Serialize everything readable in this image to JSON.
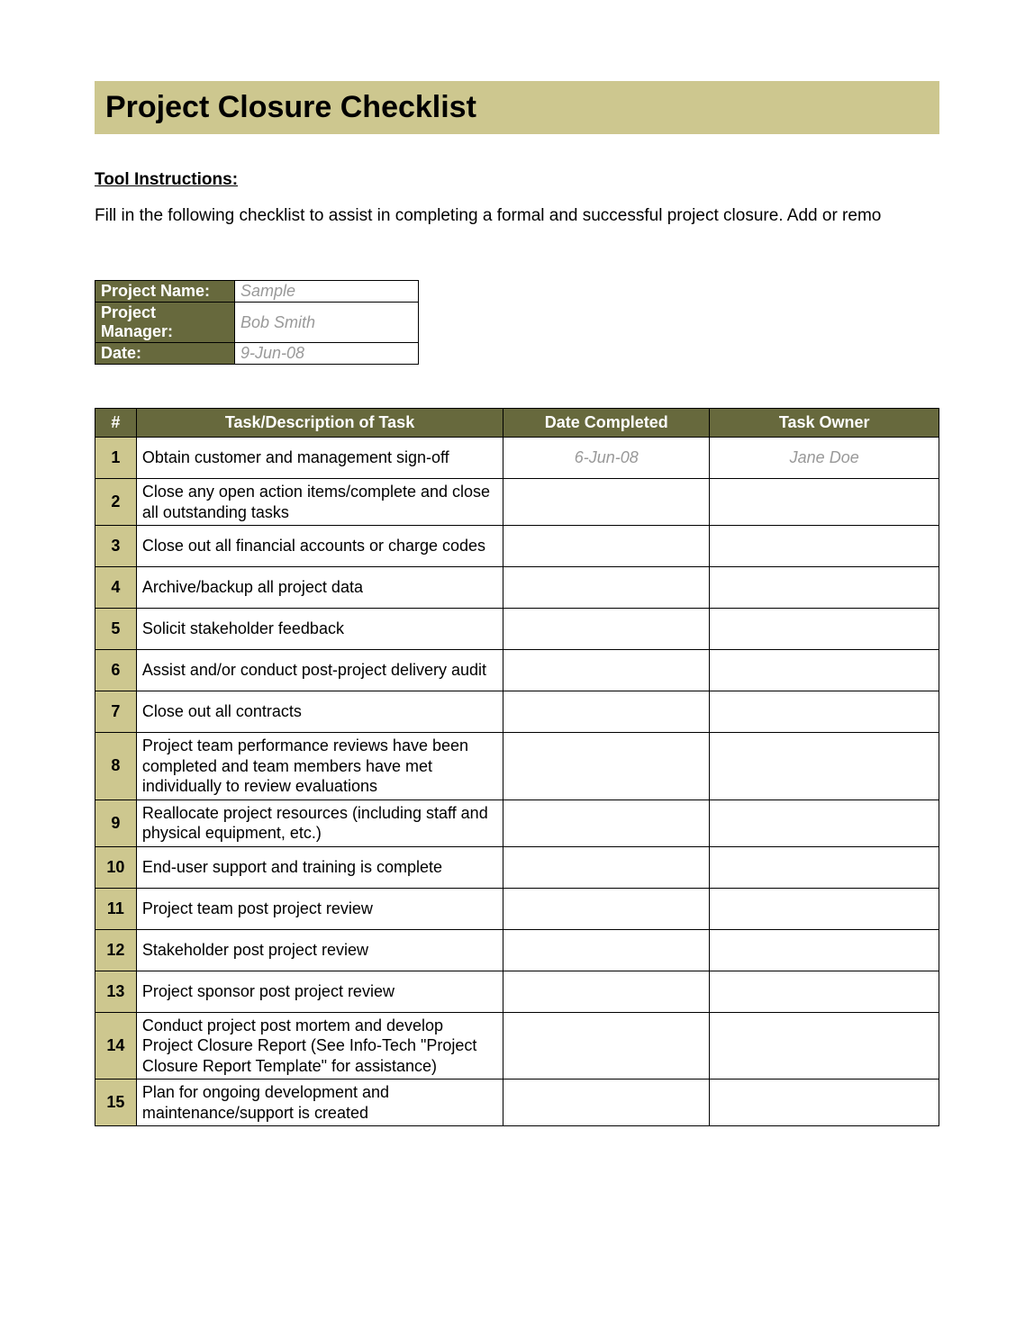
{
  "title": "Project Closure Checklist",
  "instructions": {
    "heading": "Tool Instructions:",
    "text": "Fill in the following checklist to assist in completing a formal and successful project closure. Add or remo"
  },
  "info": {
    "labels": {
      "project_name": "Project Name:",
      "project_manager": "Project Manager:",
      "date": "Date:"
    },
    "values": {
      "project_name": "Sample",
      "project_manager": "Bob Smith",
      "date": "9-Jun-08"
    }
  },
  "checklist": {
    "headers": {
      "num": "#",
      "task": "Task/Description of Task",
      "date_completed": "Date Completed",
      "task_owner": "Task Owner"
    },
    "rows": [
      {
        "num": "1",
        "task": "Obtain customer and management sign-off",
        "date": "6-Jun-08",
        "owner": "Jane Doe"
      },
      {
        "num": "2",
        "task": "Close any open action items/complete and close all outstanding tasks",
        "date": "",
        "owner": ""
      },
      {
        "num": "3",
        "task": "Close out all financial accounts or charge codes",
        "date": "",
        "owner": ""
      },
      {
        "num": "4",
        "task": "Archive/backup all project data",
        "date": "",
        "owner": ""
      },
      {
        "num": "5",
        "task": "Solicit stakeholder feedback",
        "date": "",
        "owner": ""
      },
      {
        "num": "6",
        "task": "Assist and/or conduct post-project delivery audit",
        "date": "",
        "owner": ""
      },
      {
        "num": "7",
        "task": "Close out all contracts",
        "date": "",
        "owner": ""
      },
      {
        "num": "8",
        "task": "Project team performance reviews have been completed and team members have met individually to review evaluations",
        "date": "",
        "owner": ""
      },
      {
        "num": "9",
        "task": "Reallocate project resources (including staff and physical equipment, etc.)",
        "date": "",
        "owner": ""
      },
      {
        "num": "10",
        "task": "End-user support and training is complete",
        "date": "",
        "owner": ""
      },
      {
        "num": "11",
        "task": "Project team post project review",
        "date": "",
        "owner": ""
      },
      {
        "num": "12",
        "task": "Stakeholder post project review",
        "date": "",
        "owner": ""
      },
      {
        "num": "13",
        "task": "Project sponsor post project review",
        "date": "",
        "owner": ""
      },
      {
        "num": "14",
        "task": "Conduct project post mortem and develop Project Closure Report (See Info-Tech \"Project Closure Report Template\" for assistance)",
        "date": "",
        "owner": ""
      },
      {
        "num": "15",
        "task": "Plan for ongoing development and maintenance/support is created",
        "date": "",
        "owner": ""
      }
    ]
  }
}
